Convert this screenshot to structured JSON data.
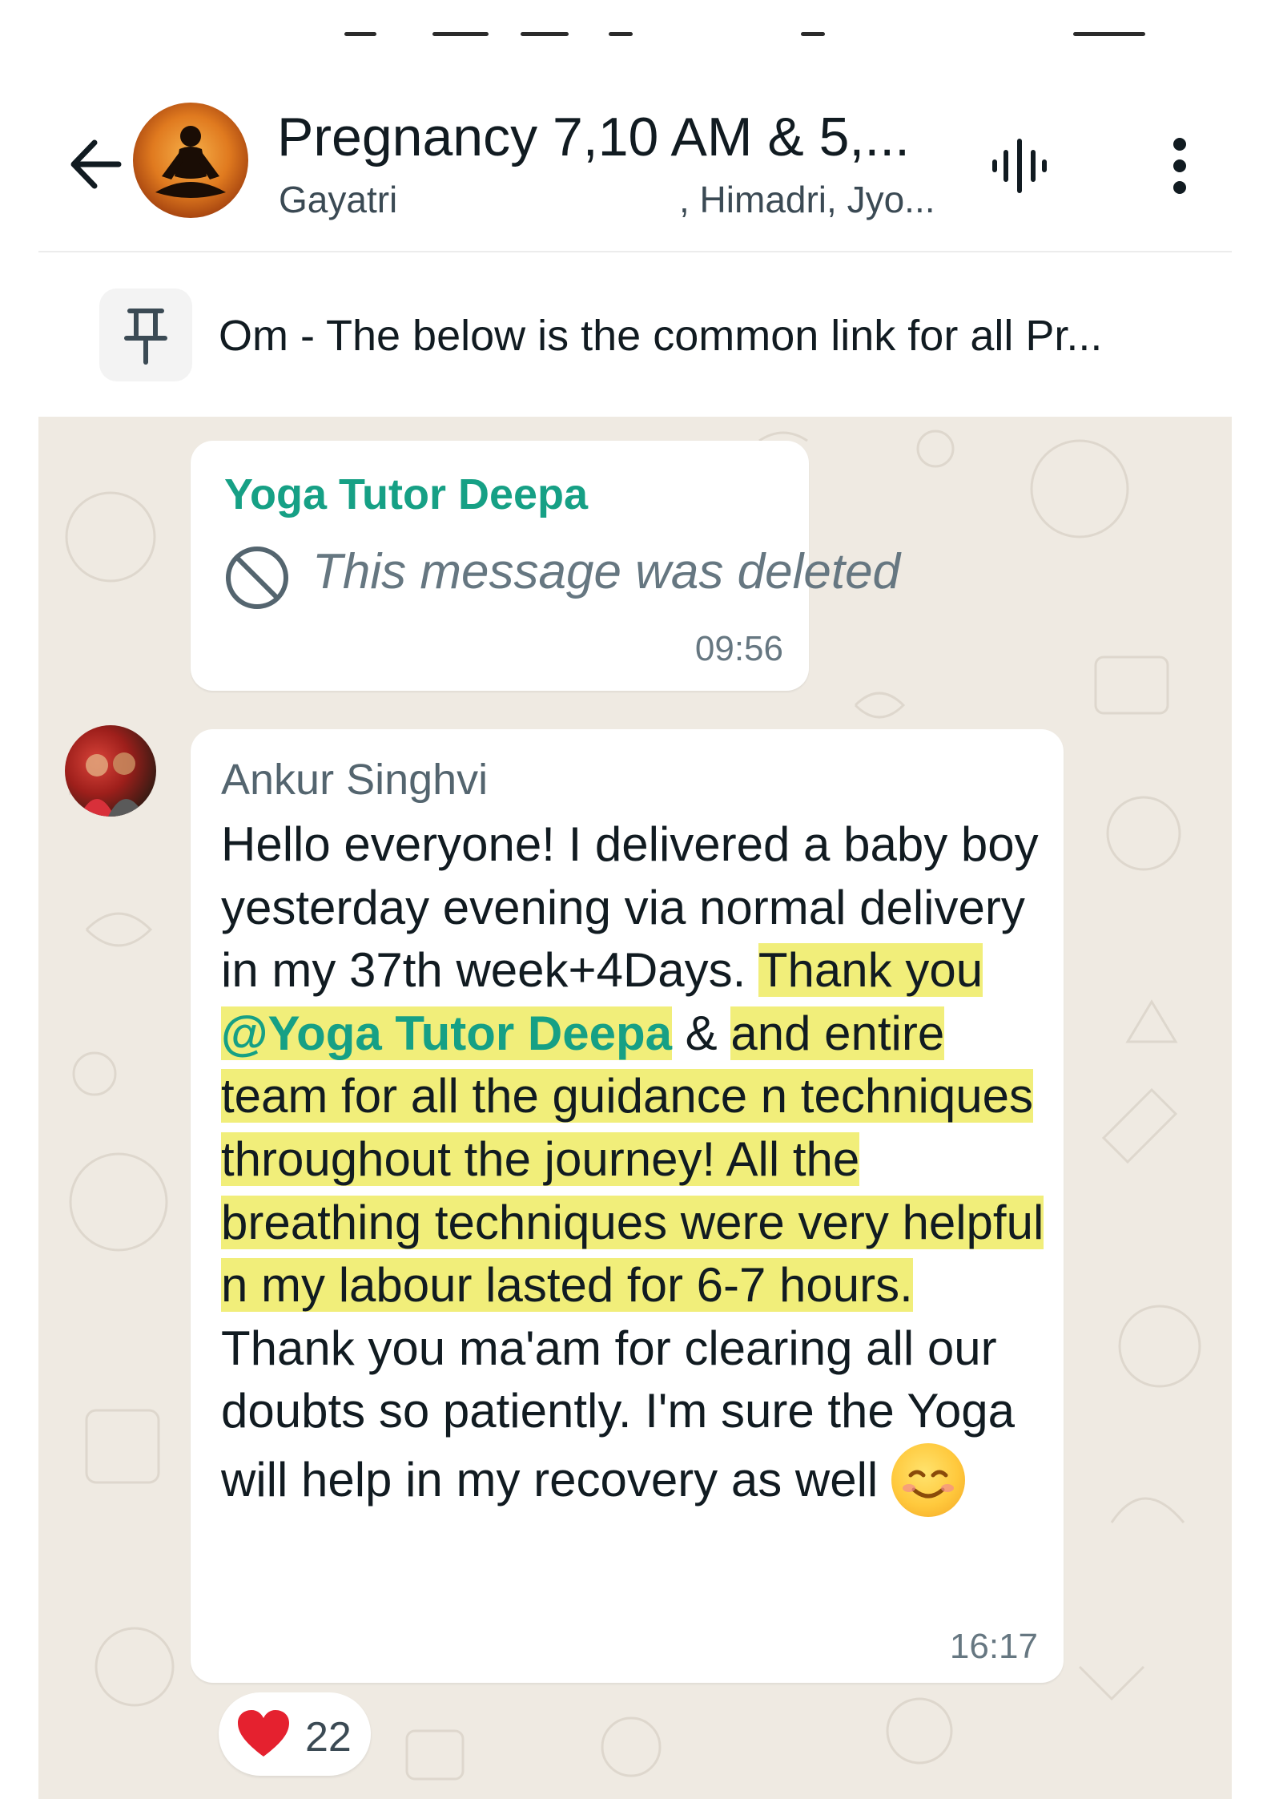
{
  "header": {
    "group_name": "Pregnancy 7,10 AM & 5,...",
    "members_part1": "Gayatri",
    "members_part2": ", Himadri, Jyo..."
  },
  "pinned": {
    "text": "Om - The below is the common link for all Pr..."
  },
  "messages": [
    {
      "sender": "Yoga Tutor Deepa",
      "text": "This message was deleted",
      "time": "09:56"
    },
    {
      "sender": "Ankur Singhvi",
      "segments": {
        "s1": "Hello everyone! I delivered a baby boy yesterday evening via normal delivery in my 37th week+4Days. ",
        "s2": "Thank you ",
        "mention": "@Yoga Tutor Deepa",
        "s3": " & ",
        "s4": "and entire team for all the guidance n techniques throughout the journey! All the breathing techniques were very helpful n my labour lasted for 6-7 hours.",
        "s5": " Thank you ma'am for clearing all our doubts so patiently. I'm sure the Yoga will help in my recovery as well "
      },
      "time": "16:17",
      "reaction": {
        "emoji": "red-heart",
        "count": "22"
      }
    }
  ],
  "colors": {
    "chat_background": "#efeae2",
    "sender_accent": "#16a085",
    "highlight": "#f1ee7a"
  }
}
